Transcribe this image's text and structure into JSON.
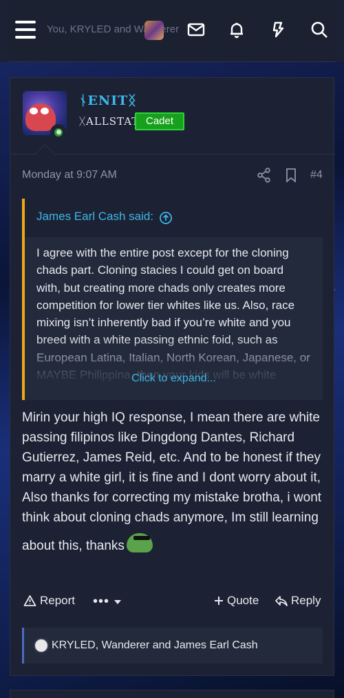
{
  "topbar": {
    "ghost_text": "You, KRYLED and Wanderer",
    "icons": [
      "menu-icon",
      "mail-icon",
      "bell-icon",
      "bolt-icon",
      "search-icon"
    ]
  },
  "post": {
    "username": "ᚾENITᛝ",
    "user_title": "ᚷALLSTATT",
    "rank": "Cadet",
    "date": "Monday at 9:07 AM",
    "post_number": "#4",
    "quote": {
      "author": "James Earl Cash said:",
      "text": "I agree with the entire post except for the cloning chads part. Cloning stacies I could get on board with, but creating more chads only creates more competition for lower tier whites like us. Also, race mixing isn’t inherently bad if you’re white and you breed with a white passing ethnic foid, such as European Latina, Italian, North Korean, Japanese, or MAYBE Philippina, then your kids will be white",
      "expand_label": "Click to expand..."
    },
    "message": "Mirin your high IQ response, I mean there are white passing filipinos like Dingdong Dantes, Richard Gutierrez, James Reid, etc. And to be honest if they marry a white girl, it is fine and I dont worry about it, Also thanks for correcting my mistake brotha, i wont think about cloning chads anymore, Im still learning about this, thanks",
    "actions": {
      "report": "Report",
      "more": "•••",
      "quote": "Quote",
      "reply": "Reply"
    },
    "reactions_text": "KRYLED, Wanderer and James Earl Cash"
  },
  "colors": {
    "accent_blue": "#3fb6e8",
    "quote_border": "#f0a81a",
    "rank_green": "#16a01c",
    "panel_bg": "#1c2233"
  }
}
